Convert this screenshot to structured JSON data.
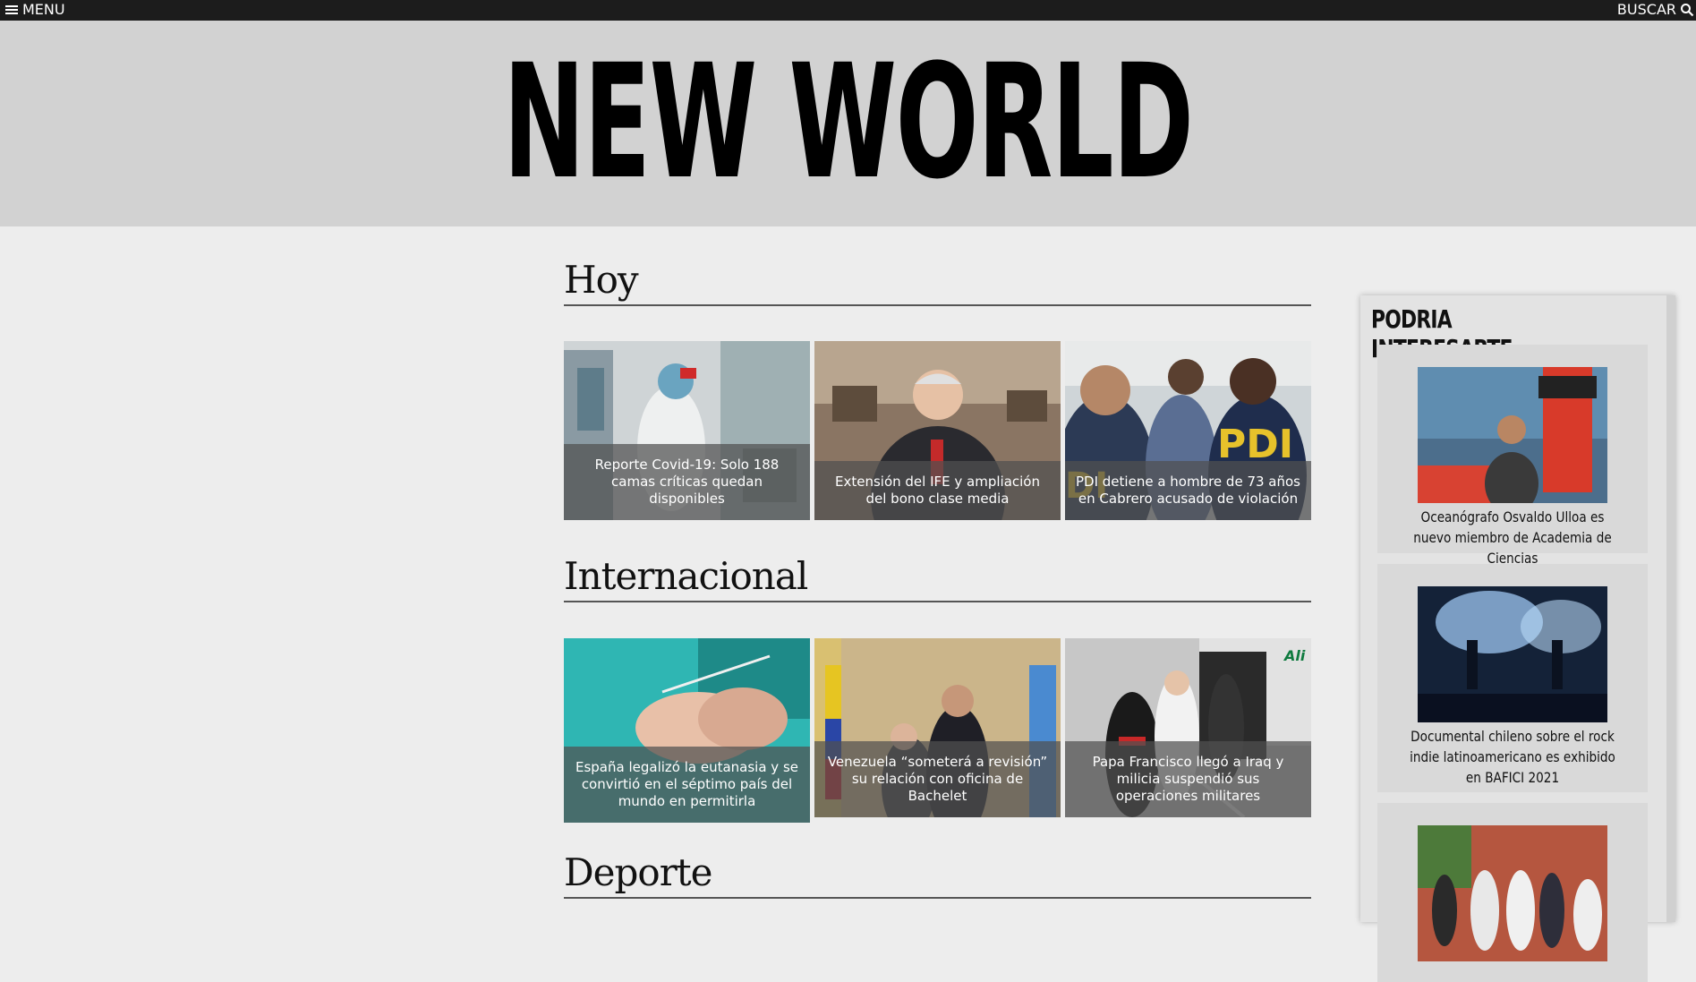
{
  "topbar": {
    "menu_label": "MENU",
    "search_label": "BUSCAR"
  },
  "masthead": {
    "title": "NEW WORLD"
  },
  "sections": {
    "hoy": {
      "title": "Hoy",
      "cards": [
        {
          "caption": "Reporte Covid-19: Solo 188 camas críticas quedan disponibles"
        },
        {
          "caption": "Extensión del IFE y ampliación del bono clase media"
        },
        {
          "caption": "PDI detiene a hombre de 73 años en Cabrero acusado de violación"
        }
      ]
    },
    "internacional": {
      "title": "Internacional",
      "cards": [
        {
          "caption": "España legalizó la eutanasia y se convirtió en el séptimo país del mundo en permitirla"
        },
        {
          "caption": "Venezuela “someterá a revisión” su relación con oficina de Bachelet"
        },
        {
          "caption": "Papa Francisco llegó a Iraq y milicia suspendió sus operaciones militares"
        }
      ]
    },
    "deporte": {
      "title": "Deporte"
    }
  },
  "sidebar": {
    "title": "PODRIA INTERESARTE...",
    "items": [
      {
        "text": "Oceanógrafo Osvaldo Ulloa es nuevo miembro de Academia de Ciencias"
      },
      {
        "text": "Documental chileno sobre el rock indie latinoamericano es exhibido en BAFICI 2021"
      },
      {
        "text": ""
      }
    ]
  }
}
